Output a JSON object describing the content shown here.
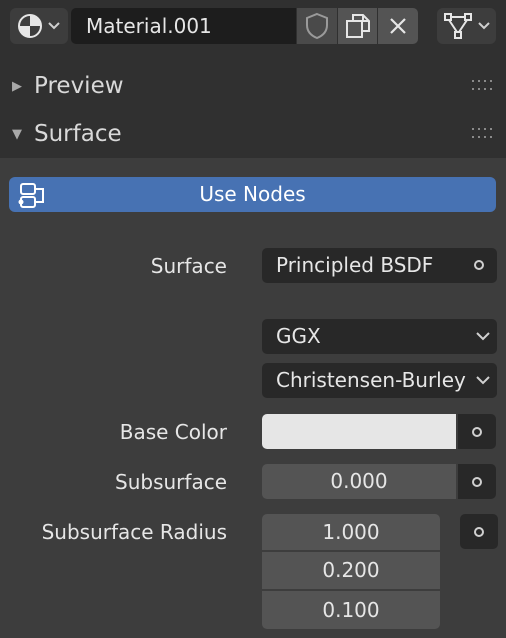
{
  "header": {
    "material_name": "Material.001",
    "icons": {
      "material_type": "sphere-preview-icon",
      "fake_user": "shield-icon",
      "duplicate": "duplicate-icon",
      "unlink": "close-icon",
      "node_menu": "node-tree-icon"
    }
  },
  "panels": {
    "preview": {
      "title": "Preview",
      "expanded": false
    },
    "surface": {
      "title": "Surface",
      "expanded": true
    }
  },
  "surface": {
    "use_nodes_label": "Use Nodes",
    "surface_label": "Surface",
    "surface_shader": "Principled BSDF",
    "distribution": "GGX",
    "subsurface_method": "Christensen-Burley",
    "base_color_label": "Base Color",
    "base_color_value": "#e6e6e6",
    "subsurface_label": "Subsurface",
    "subsurface_value": "0.000",
    "subsurface_radius_label": "Subsurface Radius",
    "subsurface_radius": [
      "1.000",
      "0.200",
      "0.100"
    ]
  },
  "colors": {
    "accent": "#4772b3",
    "panel_bg": "#3d3d3d",
    "header_bg": "#303030"
  }
}
